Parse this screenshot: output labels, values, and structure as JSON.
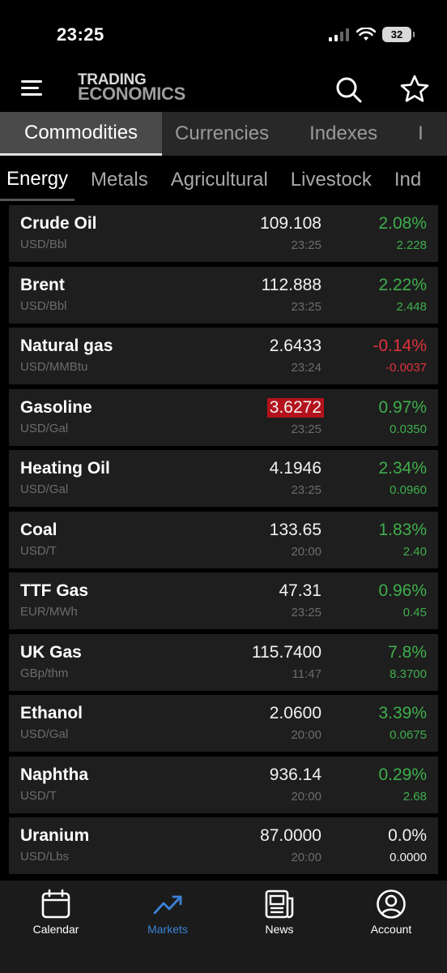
{
  "status_bar": {
    "time": "23:25",
    "battery": "32"
  },
  "header": {
    "logo_line1": "TRADING",
    "logo_line2": "ECONOMICS",
    "icons": [
      "menu-icon",
      "search-icon",
      "star-icon"
    ]
  },
  "main_tabs": [
    {
      "label": "Commodities",
      "active": true
    },
    {
      "label": "Currencies",
      "active": false
    },
    {
      "label": "Indexes",
      "active": false
    },
    {
      "label": "I",
      "active": false
    }
  ],
  "sub_tabs": [
    {
      "label": "Energy",
      "active": true
    },
    {
      "label": "Metals",
      "active": false
    },
    {
      "label": "Agricultural",
      "active": false
    },
    {
      "label": "Livestock",
      "active": false
    },
    {
      "label": "Ind",
      "active": false
    }
  ],
  "rows": [
    {
      "name": "Crude Oil",
      "unit": "USD/Bbl",
      "price": "109.108",
      "time": "23:25",
      "pct": "2.08%",
      "change": "2.228",
      "direction": "up"
    },
    {
      "name": "Brent",
      "unit": "USD/Bbl",
      "price": "112.888",
      "time": "23:25",
      "pct": "2.22%",
      "change": "2.448",
      "direction": "up"
    },
    {
      "name": "Natural gas",
      "unit": "USD/MMBtu",
      "price": "2.6433",
      "time": "23:24",
      "pct": "-0.14%",
      "change": "-0.0037",
      "direction": "down"
    },
    {
      "name": "Gasoline",
      "unit": "USD/Gal",
      "price": "3.6272",
      "time": "23:25",
      "pct": "0.97%",
      "change": "0.0350",
      "direction": "up",
      "highlight": true
    },
    {
      "name": "Heating Oil",
      "unit": "USD/Gal",
      "price": "4.1946",
      "time": "23:25",
      "pct": "2.34%",
      "change": "0.0960",
      "direction": "up"
    },
    {
      "name": "Coal",
      "unit": "USD/T",
      "price": "133.65",
      "time": "20:00",
      "pct": "1.83%",
      "change": "2.40",
      "direction": "up"
    },
    {
      "name": "TTF Gas",
      "unit": "EUR/MWh",
      "price": "47.31",
      "time": "23:25",
      "pct": "0.96%",
      "change": "0.45",
      "direction": "up"
    },
    {
      "name": "UK Gas",
      "unit": "GBp/thm",
      "price": "115.7400",
      "time": "11:47",
      "pct": "7.8%",
      "change": "8.3700",
      "direction": "up"
    },
    {
      "name": "Ethanol",
      "unit": "USD/Gal",
      "price": "2.0600",
      "time": "20:00",
      "pct": "3.39%",
      "change": "0.0675",
      "direction": "up"
    },
    {
      "name": "Naphtha",
      "unit": "USD/T",
      "price": "936.14",
      "time": "20:00",
      "pct": "0.29%",
      "change": "2.68",
      "direction": "up"
    },
    {
      "name": "Uranium",
      "unit": "USD/Lbs",
      "price": "87.0000",
      "time": "20:00",
      "pct": "0.0%",
      "change": "0.0000",
      "direction": "flat"
    }
  ],
  "bottom_nav": [
    {
      "label": "Calendar",
      "icon": "calendar-icon",
      "active": false
    },
    {
      "label": "Markets",
      "icon": "trending-up-icon",
      "active": true
    },
    {
      "label": "News",
      "icon": "newspaper-icon",
      "active": false
    },
    {
      "label": "Account",
      "icon": "account-icon",
      "active": false
    }
  ],
  "colors": {
    "up": "#3fae4c",
    "down": "#e0333c",
    "highlight": "#b3121c",
    "accent": "#3b82d6"
  }
}
